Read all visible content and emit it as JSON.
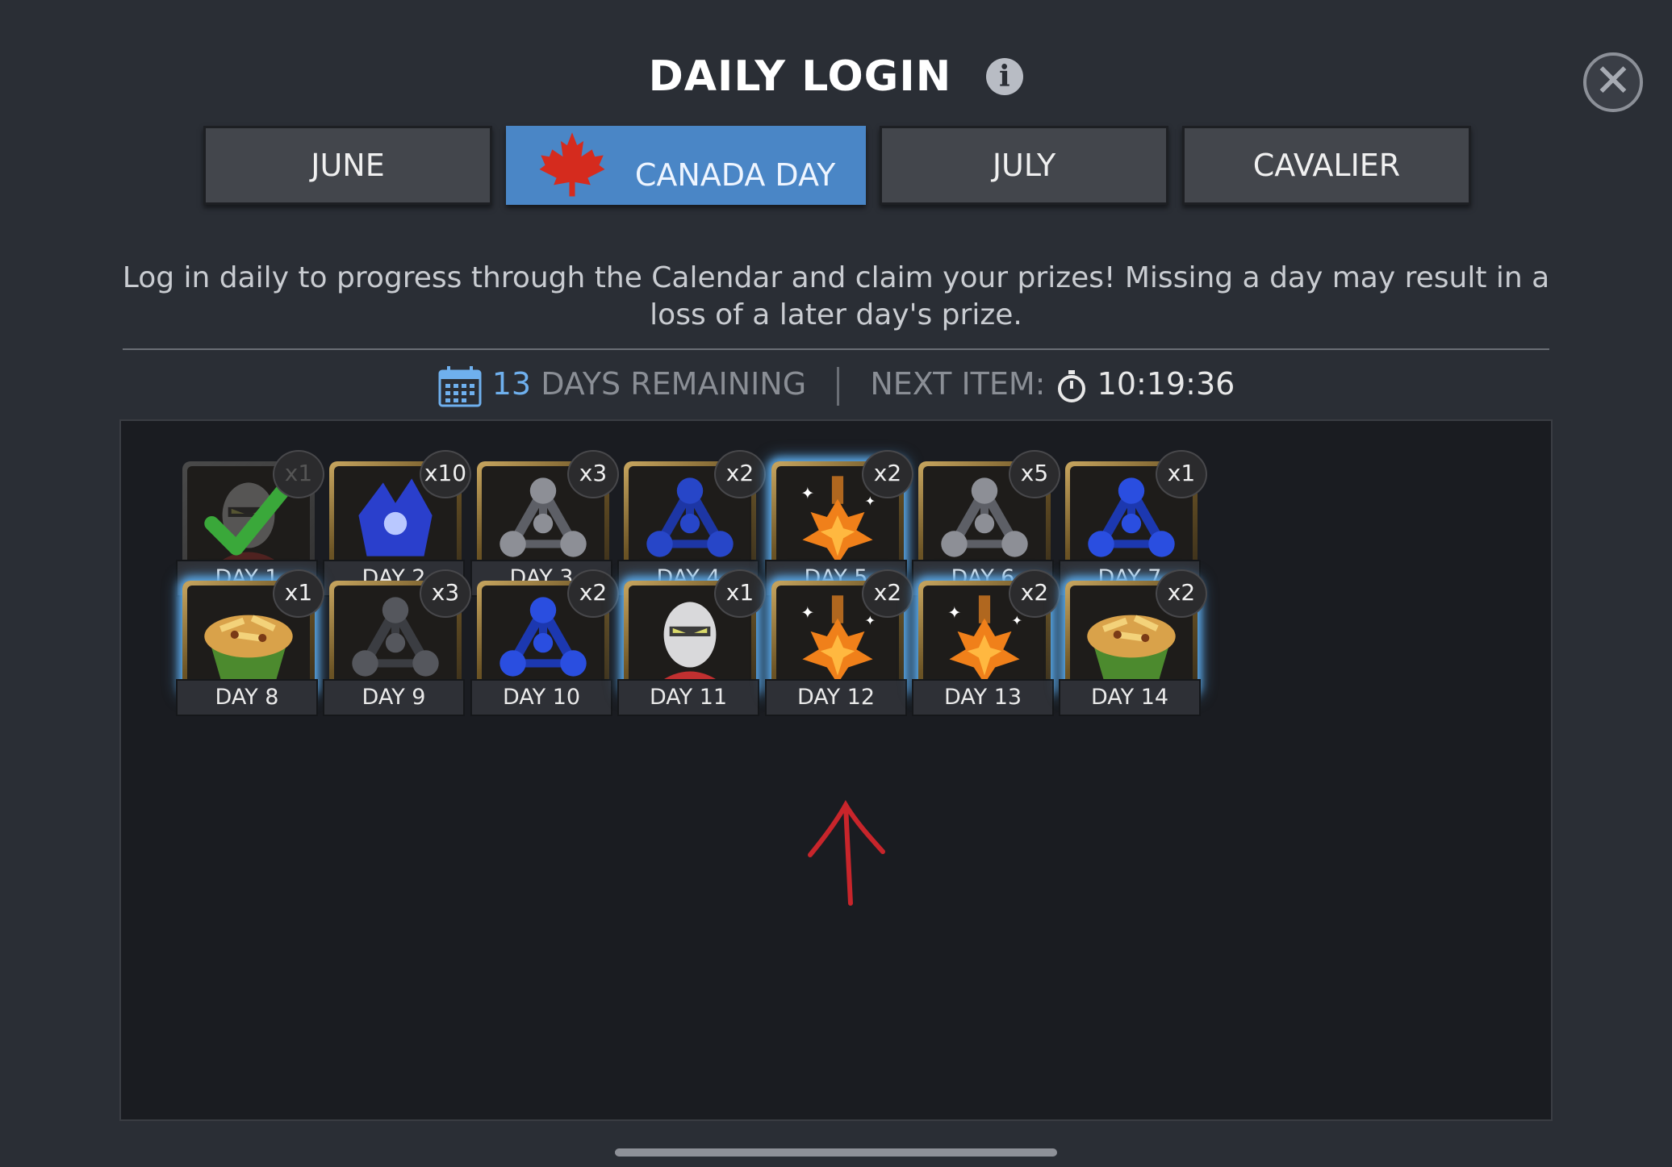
{
  "header": {
    "title": "DAILY LOGIN",
    "info_icon": "info-icon",
    "close_icon": "close-icon"
  },
  "tabs": [
    {
      "label": "JUNE",
      "active": false
    },
    {
      "label": "CANADA DAY",
      "active": true,
      "icon": "maple-leaf-icon"
    },
    {
      "label": "JULY",
      "active": false
    },
    {
      "label": "CAVALIER",
      "active": false
    }
  ],
  "description": "Log in daily to progress through the Calendar and claim your prizes! Missing a day may result in a loss of a later day's prize.",
  "status": {
    "days_remaining_count": "13",
    "days_remaining_label": "DAYS REMAINING",
    "next_item_label": "NEXT ITEM:",
    "next_item_time": "10:19:36"
  },
  "days": [
    {
      "label": "DAY 1",
      "qty": "x1",
      "item": "champion",
      "claimed": true,
      "glow": false
    },
    {
      "label": "DAY 2",
      "qty": "x10",
      "item": "crystal-shard",
      "glow": false
    },
    {
      "label": "DAY 3",
      "qty": "x3",
      "item": "catalyst-gray",
      "glow": false
    },
    {
      "label": "DAY 4",
      "qty": "x2",
      "item": "catalyst-blue",
      "glow": false
    },
    {
      "label": "DAY 5",
      "qty": "x2",
      "item": "maple-syrup",
      "glow": true
    },
    {
      "label": "DAY 6",
      "qty": "x5",
      "item": "catalyst-gray",
      "glow": false
    },
    {
      "label": "DAY 7",
      "qty": "x1",
      "item": "catalyst-blue-large",
      "glow": false
    },
    {
      "label": "DAY 8",
      "qty": "x1",
      "item": "poutine",
      "glow": true
    },
    {
      "label": "DAY 9",
      "qty": "x3",
      "item": "catalyst-dark",
      "glow": false
    },
    {
      "label": "DAY 10",
      "qty": "x2",
      "item": "catalyst-blue-large",
      "glow": false
    },
    {
      "label": "DAY 11",
      "qty": "x1",
      "item": "champion",
      "glow": true
    },
    {
      "label": "DAY 12",
      "qty": "x2",
      "item": "maple-syrup",
      "glow": true
    },
    {
      "label": "DAY 13",
      "qty": "x2",
      "item": "maple-syrup",
      "glow": true
    },
    {
      "label": "DAY 14",
      "qty": "x2",
      "item": "poutine",
      "glow": true
    }
  ],
  "colors": {
    "accent": "#4a86c6",
    "highlight": "#6fb0ee",
    "annotation": "#c8252b"
  }
}
